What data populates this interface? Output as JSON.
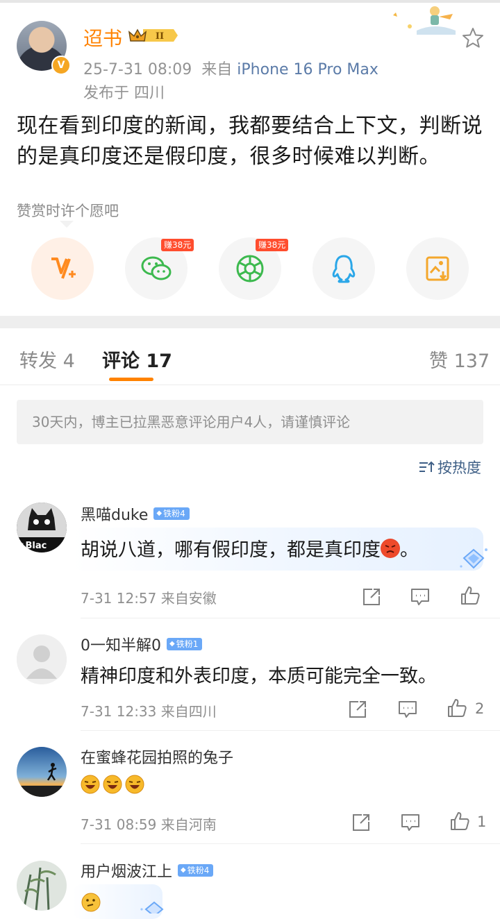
{
  "post": {
    "author": "迢书",
    "level": "II",
    "verified_mark": "V",
    "time": "25-7-31 08:09",
    "source_prefix": "来自",
    "device": "iPhone 16 Pro Max",
    "location": "发布于 四川",
    "text": "现在看到印度的新闻，我都要结合上下文，判断说的是真印度还是假印度，很多时候难以判断。",
    "reward_hint": "赞赏时许个愿吧"
  },
  "share": [
    {
      "icon": "v-plus-icon",
      "badge": ""
    },
    {
      "icon": "wechat-icon",
      "badge": "赚38元"
    },
    {
      "icon": "moments-icon",
      "badge": "赚38元"
    },
    {
      "icon": "qq-icon",
      "badge": ""
    },
    {
      "icon": "save-image-icon",
      "badge": ""
    }
  ],
  "tabs": {
    "repost": "转发 4",
    "comments": "评论 17",
    "likes": "赞 137"
  },
  "notice": "30天内，博主已拉黑恶意评论用户4人，请谨慎评论",
  "sort_label": "按热度",
  "comments": [
    {
      "name": "黑喵duke",
      "fan": "铁粉4",
      "text": "胡说八道，哪有假印度，都是真印度",
      "text_end": "。",
      "meta": "7-31 12:57  来自安徽",
      "likes": ""
    },
    {
      "name": "0一知半解0",
      "fan": "铁粉1",
      "text": "精神印度和外表印度，本质可能完全一致。",
      "meta": "7-31 12:33  来自四川",
      "likes": "2"
    },
    {
      "name": "在蜜蜂花园拍照的兔子",
      "fan": "",
      "text": "",
      "meta": "7-31 08:59  来自河南",
      "likes": "1"
    },
    {
      "name": "用户烟波江上",
      "fan": "铁粉4",
      "text": "",
      "meta": "",
      "likes": ""
    }
  ],
  "colors": {
    "accent": "#ff8200",
    "link": "#5b7ba8",
    "fan_badge": "#6aa8f7",
    "earn_badge": "#ff4d2e"
  }
}
